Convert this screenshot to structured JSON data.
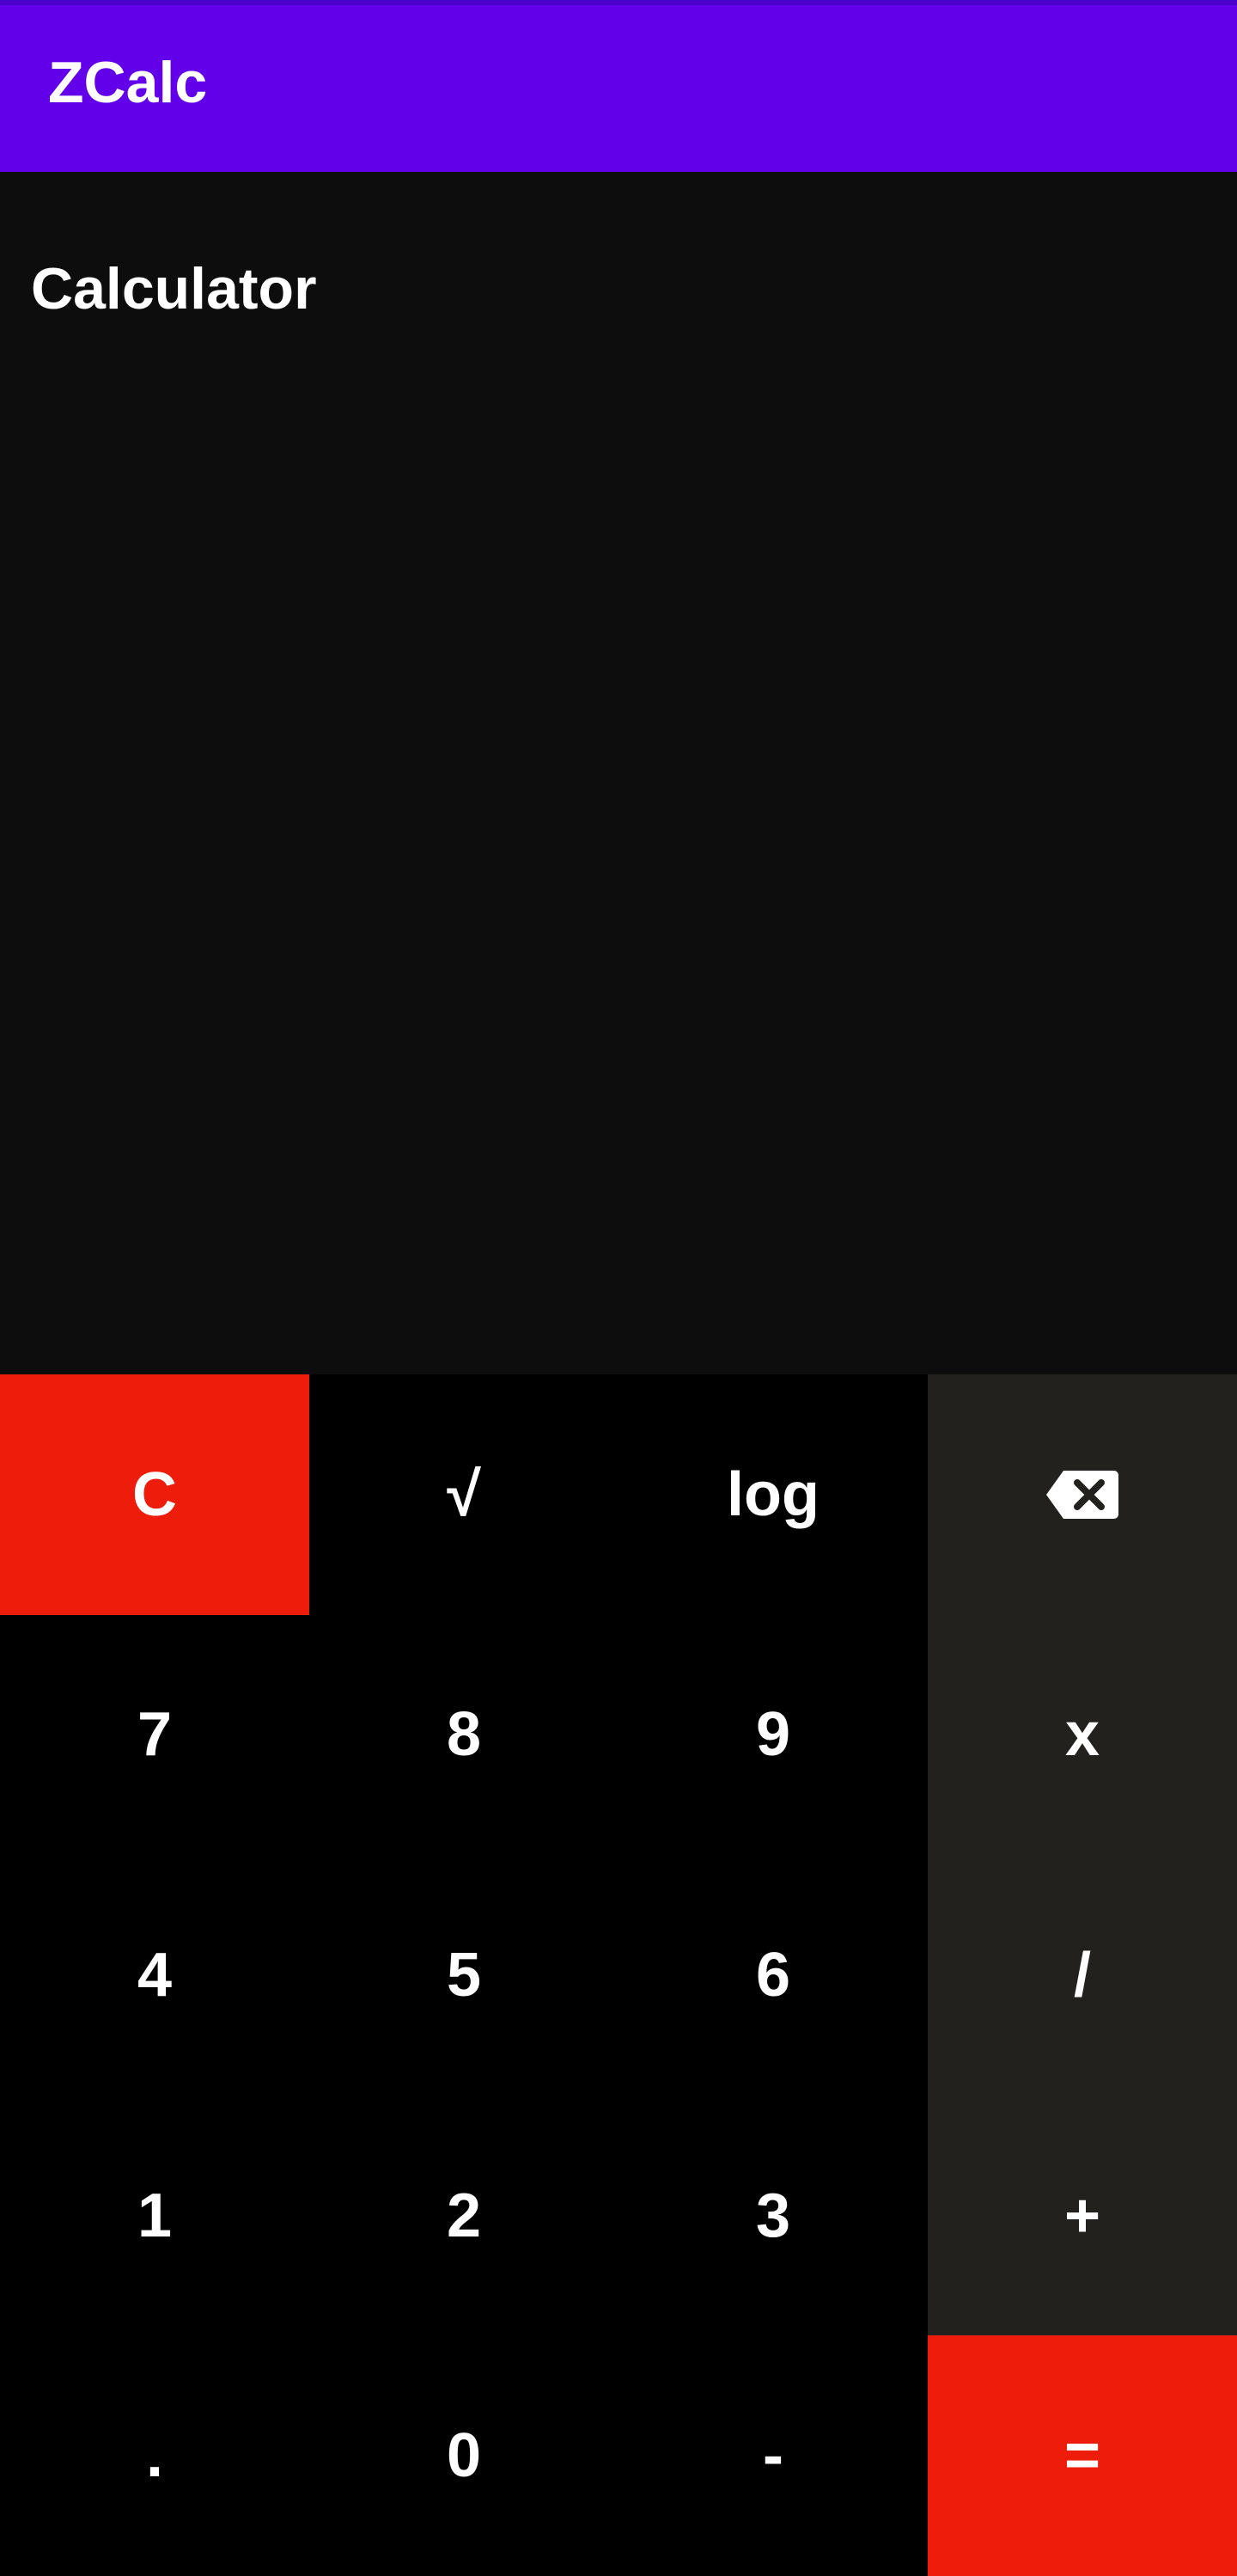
{
  "app_bar": {
    "title": "ZCalc",
    "color": "#6200ea"
  },
  "display": {
    "title": "Calculator"
  },
  "colors": {
    "accent": "#ee1c0a",
    "operator_bg": "#22211e",
    "digit_bg": "#000000",
    "display_bg": "#0e0d0e"
  },
  "keys": {
    "clear": "C",
    "sqrt": "√",
    "log": "log",
    "backspace_icon": "backspace-icon",
    "seven": "7",
    "eight": "8",
    "nine": "9",
    "multiply": "x",
    "four": "4",
    "five": "5",
    "six": "6",
    "divide": "/",
    "one": "1",
    "two": "2",
    "three": "3",
    "plus": "+",
    "dot": ".",
    "zero": "0",
    "minus": "-",
    "equals": "="
  }
}
